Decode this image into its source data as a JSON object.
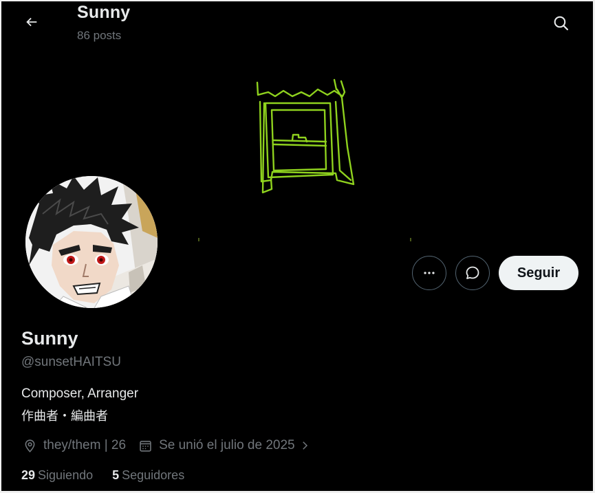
{
  "header": {
    "title": "Sunny",
    "post_count": "86 posts",
    "back_icon": "arrow-left-icon",
    "search_icon": "search-icon"
  },
  "banner": {
    "description_icon": "window-doodle",
    "doodle_color": "#8fd21e"
  },
  "avatar": {
    "icon": "avatar"
  },
  "actions": {
    "more_icon": "ellipsis-icon",
    "message_icon": "message-bubble-icon",
    "follow_label": "Seguir"
  },
  "profile": {
    "display_name": "Sunny",
    "handle": "@sunsetHAITSU",
    "bio_line1": "Composer, Arranger",
    "bio_line2": "作曲者・編曲者",
    "location": "they/them | 26",
    "location_icon": "location-pin-icon",
    "joined": "Se unió el julio de 2025",
    "joined_icon": "calendar-icon",
    "joined_chevron_icon": "chevron-right-icon"
  },
  "stats": {
    "following_count": "29",
    "following_label": "Siguiendo",
    "followers_count": "5",
    "followers_label": "Seguidores"
  },
  "colors": {
    "background": "#000000",
    "primary_text": "#e7e9ea",
    "secondary_text": "#71767b",
    "button_border": "#536471",
    "follow_button_bg": "#eff3f4",
    "follow_button_text": "#0f1419"
  }
}
